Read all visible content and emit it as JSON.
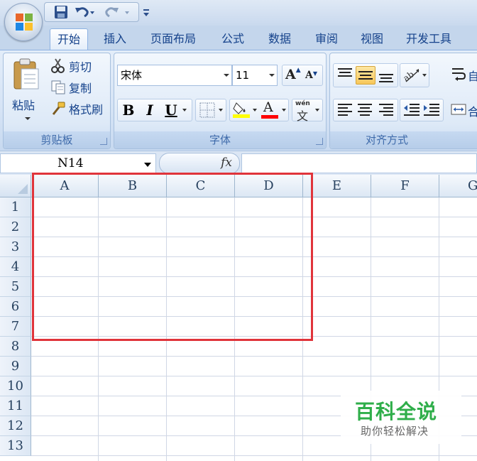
{
  "tabs": [
    "开始",
    "插入",
    "页面布局",
    "公式",
    "数据",
    "审阅",
    "视图",
    "开发工具"
  ],
  "active_tab": "开始",
  "clipboard": {
    "paste": "粘贴",
    "cut": "剪切",
    "copy": "复制",
    "format_painter": "格式刷",
    "group_label": "剪贴板"
  },
  "font": {
    "name": "宋体",
    "size": "11",
    "bold": "B",
    "italic": "I",
    "underline": "U",
    "font_color_glyph": "A",
    "phonetic_top": "wén",
    "phonetic_char": "文",
    "group_label": "字体"
  },
  "alignment": {
    "group_label": "对齐方式",
    "wrap_partial": "自",
    "merge_partial": "合"
  },
  "name_box": "N14",
  "fx_label": "fx",
  "columns": [
    "A",
    "B",
    "C",
    "D",
    "E",
    "F",
    "G"
  ],
  "rows": [
    "1",
    "2",
    "3",
    "4",
    "5",
    "6",
    "7",
    "8",
    "9",
    "10",
    "11",
    "12",
    "13"
  ],
  "watermark": {
    "title": "百科全说",
    "subtitle": "助你轻松解决"
  },
  "colors": {
    "highlight_red": "#e0343b",
    "fill_yellow": "#ffff00",
    "font_red": "#ff0000",
    "watermark_green": "#2fae4a"
  }
}
